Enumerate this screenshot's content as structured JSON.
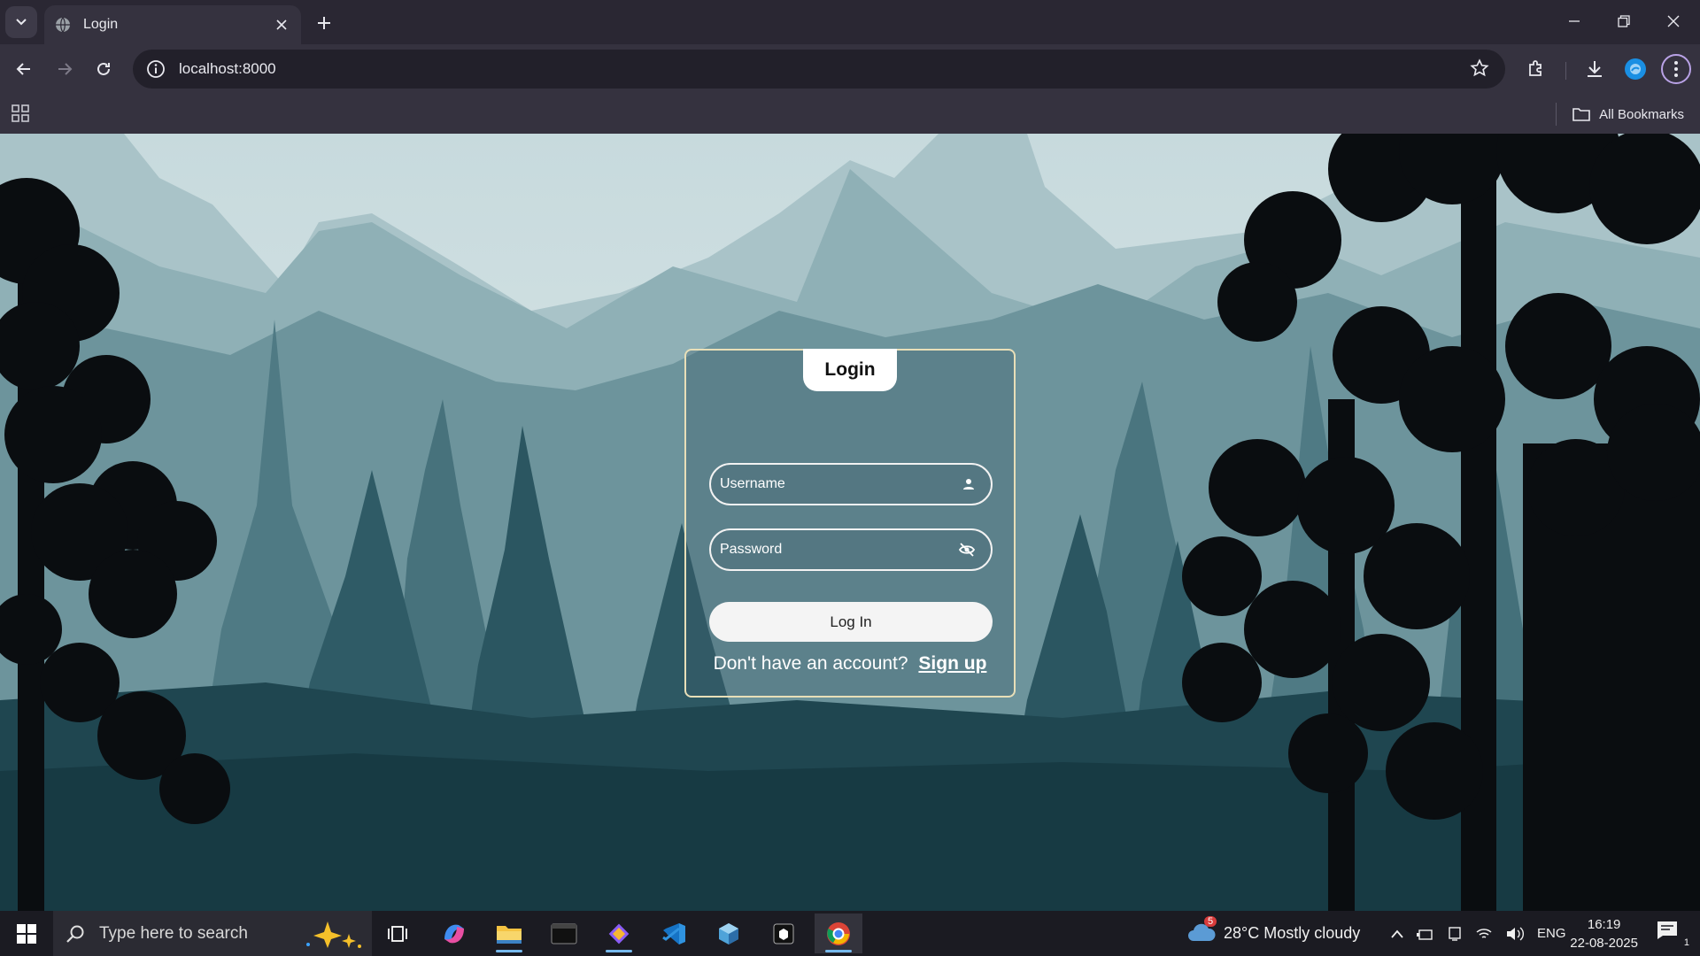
{
  "browser": {
    "tab_title": "Login",
    "url": "localhost:8000",
    "bookmarks_label": "All Bookmarks"
  },
  "login": {
    "title": "Login",
    "username_placeholder": "Username",
    "password_placeholder": "Password",
    "login_button": "Log In",
    "signup_prompt": "Don't have an account?",
    "signup_link": "Sign up"
  },
  "taskbar": {
    "search_placeholder": "Type here to search",
    "weather_badge": "5",
    "weather": "28°C  Mostly cloudy",
    "language": "ENG",
    "time": "16:19",
    "date": "22-08-2025",
    "notifications": "1"
  },
  "colors": {
    "card_border": "#e8dfb8",
    "accent": "#76b9ed"
  }
}
